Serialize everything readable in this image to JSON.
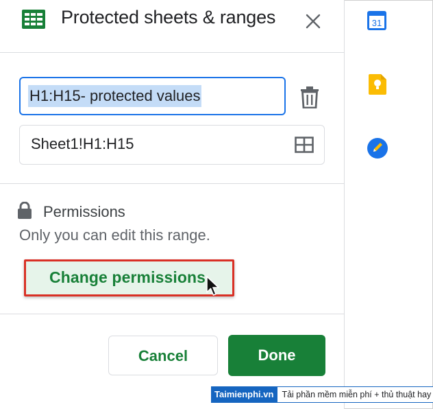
{
  "header": {
    "title": "Protected sheets & ranges",
    "icon": "sheets-icon",
    "close_icon": "close-icon"
  },
  "range_form": {
    "description_value": "H1:H15- protected values",
    "range_value": "Sheet1!H1:H15",
    "delete_icon": "trash-icon",
    "select_range_icon": "grid-icon"
  },
  "permissions": {
    "title": "Permissions",
    "description": "Only you can edit this range.",
    "change_button": "Change permissions"
  },
  "footer": {
    "cancel_label": "Cancel",
    "done_label": "Done"
  },
  "side_panel": {
    "calendar_day": "31",
    "icons": [
      "calendar-icon",
      "keep-icon",
      "tasks-icon"
    ]
  },
  "watermark": {
    "brand": "Taimienphi.vn",
    "tagline": "Tải phần mềm miễn phí + thủ thuật hay"
  },
  "colors": {
    "accent_blue": "#1a73e8",
    "green": "#188038",
    "highlight_red": "#d93025",
    "selection_bg": "#c4dcf7"
  }
}
